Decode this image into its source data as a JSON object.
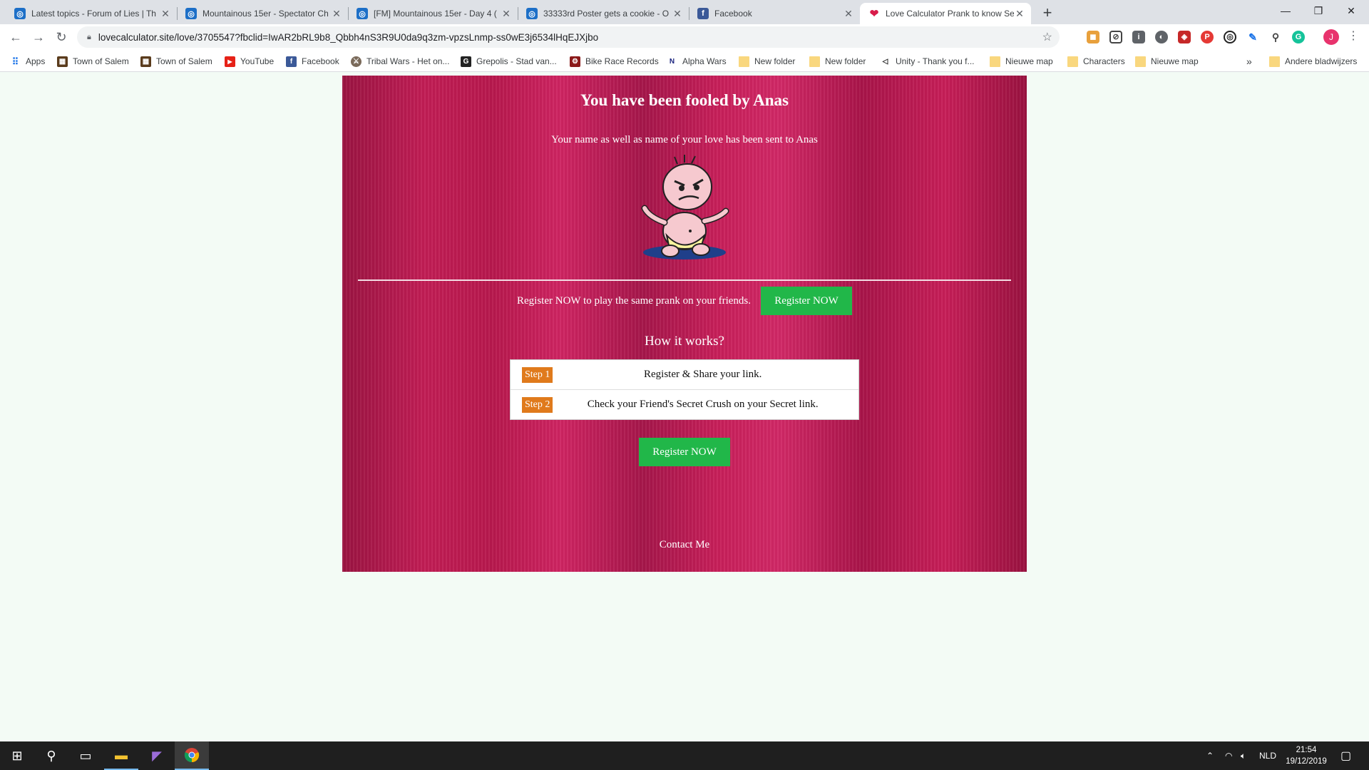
{
  "browser": {
    "tabs": [
      {
        "title": "Latest topics - Forum of Lies | Th",
        "favicon": "forum-icon"
      },
      {
        "title": "Mountainous 15er - Spectator Ch",
        "favicon": "forum-icon"
      },
      {
        "title": "[FM] Mountainous 15er - Day 4 (",
        "favicon": "forum-icon"
      },
      {
        "title": "33333rd Poster gets a cookie - O",
        "favicon": "forum-icon"
      },
      {
        "title": "Facebook",
        "favicon": "facebook-icon"
      },
      {
        "title": "Love Calculator Prank to know Se",
        "favicon": "heart-icon",
        "active": true
      }
    ],
    "url": "lovecalculator.site/love/3705547?fbclid=IwAR2bRL9b8_Qbbh4nS3R9U0da9q3zm-vpzsLnmp-ss0wE3j6534lHqEJXjbo",
    "profile_initial": "J",
    "bookmarks": [
      {
        "label": "Apps",
        "icon": "apps-grid-icon"
      },
      {
        "label": "Town of Salem",
        "icon": "town-of-salem-icon"
      },
      {
        "label": "Town of Salem",
        "icon": "town-of-salem-icon"
      },
      {
        "label": "YouTube",
        "icon": "youtube-icon"
      },
      {
        "label": "Facebook",
        "icon": "facebook-icon"
      },
      {
        "label": "Tribal Wars - Het on...",
        "icon": "tribal-wars-icon"
      },
      {
        "label": "Grepolis - Stad van...",
        "icon": "grepolis-icon"
      },
      {
        "label": "Bike Race Records",
        "icon": "bike-icon"
      },
      {
        "label": "Alpha Wars",
        "icon": "alpha-wars-icon"
      },
      {
        "label": "New folder",
        "icon": "folder-icon"
      },
      {
        "label": "New folder",
        "icon": "folder-icon"
      },
      {
        "label": "Unity - Thank you f...",
        "icon": "unity-icon"
      },
      {
        "label": "Nieuwe map",
        "icon": "folder-icon"
      },
      {
        "label": "Characters",
        "icon": "folder-icon"
      },
      {
        "label": "Nieuwe map",
        "icon": "folder-icon"
      }
    ],
    "bookmarks_overflow": "»",
    "other_bookmarks": "Andere bladwijzers"
  },
  "page": {
    "headline": "You have been fooled by Anas",
    "subline": "Your name as well as name of your love has been sent to Anas",
    "promo_text": "Register NOW to play the same prank on your friends.",
    "register_label": "Register NOW",
    "how_title": "How it works?",
    "steps": [
      {
        "badge": "Step 1",
        "text": "Register & Share your link."
      },
      {
        "badge": "Step 2",
        "text": "Check your Friend's Secret Crush on your Secret link."
      }
    ],
    "register_label_bottom": "Register NOW",
    "contact": "Contact Me",
    "colors": {
      "panel": "#c21d55",
      "button": "#21b749",
      "step_badge": "#e07a1c"
    }
  },
  "taskbar": {
    "language": "NLD",
    "time": "21:54",
    "date": "19/12/2019"
  }
}
